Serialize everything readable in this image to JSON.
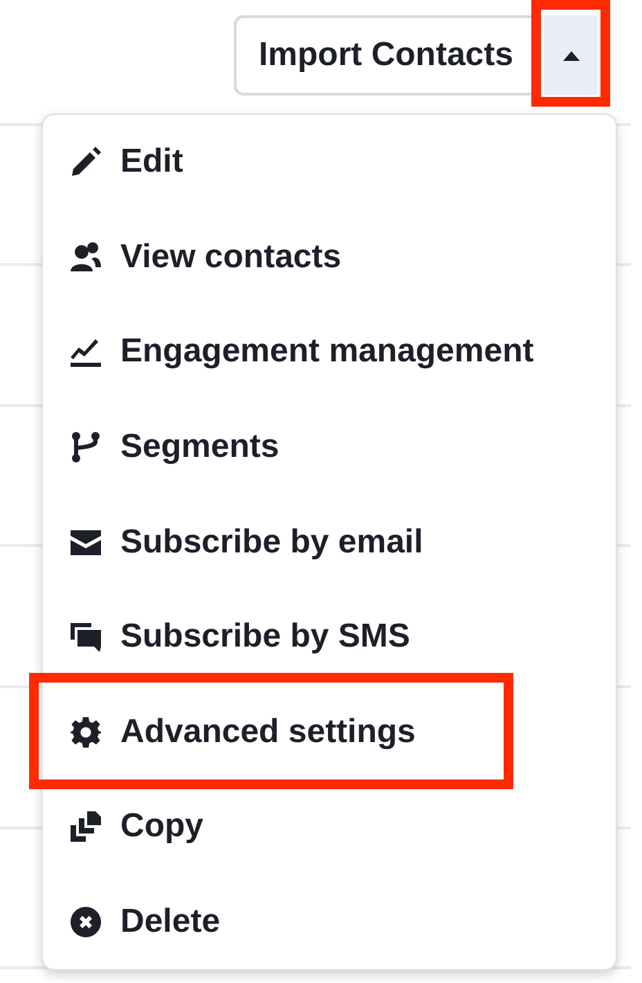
{
  "toolbar": {
    "import_button": {
      "label": "Import Contacts"
    },
    "menu_toggle": {
      "expanded": true,
      "highlighted": true
    }
  },
  "menu": {
    "items": [
      {
        "label": "Edit",
        "kind": "pencil",
        "highlighted": false
      },
      {
        "label": "View contacts",
        "kind": "people",
        "highlighted": false
      },
      {
        "label": "Engagement management",
        "kind": "chart",
        "highlighted": false
      },
      {
        "label": "Segments",
        "kind": "branch",
        "highlighted": false
      },
      {
        "label": "Subscribe by email",
        "kind": "envelope",
        "highlighted": false
      },
      {
        "label": "Subscribe by SMS",
        "kind": "chat",
        "highlighted": false
      },
      {
        "label": "Advanced settings",
        "kind": "gear",
        "highlighted": true
      },
      {
        "label": "Copy",
        "kind": "copy",
        "highlighted": false
      },
      {
        "label": "Delete",
        "kind": "xcircle",
        "highlighted": false
      }
    ]
  }
}
